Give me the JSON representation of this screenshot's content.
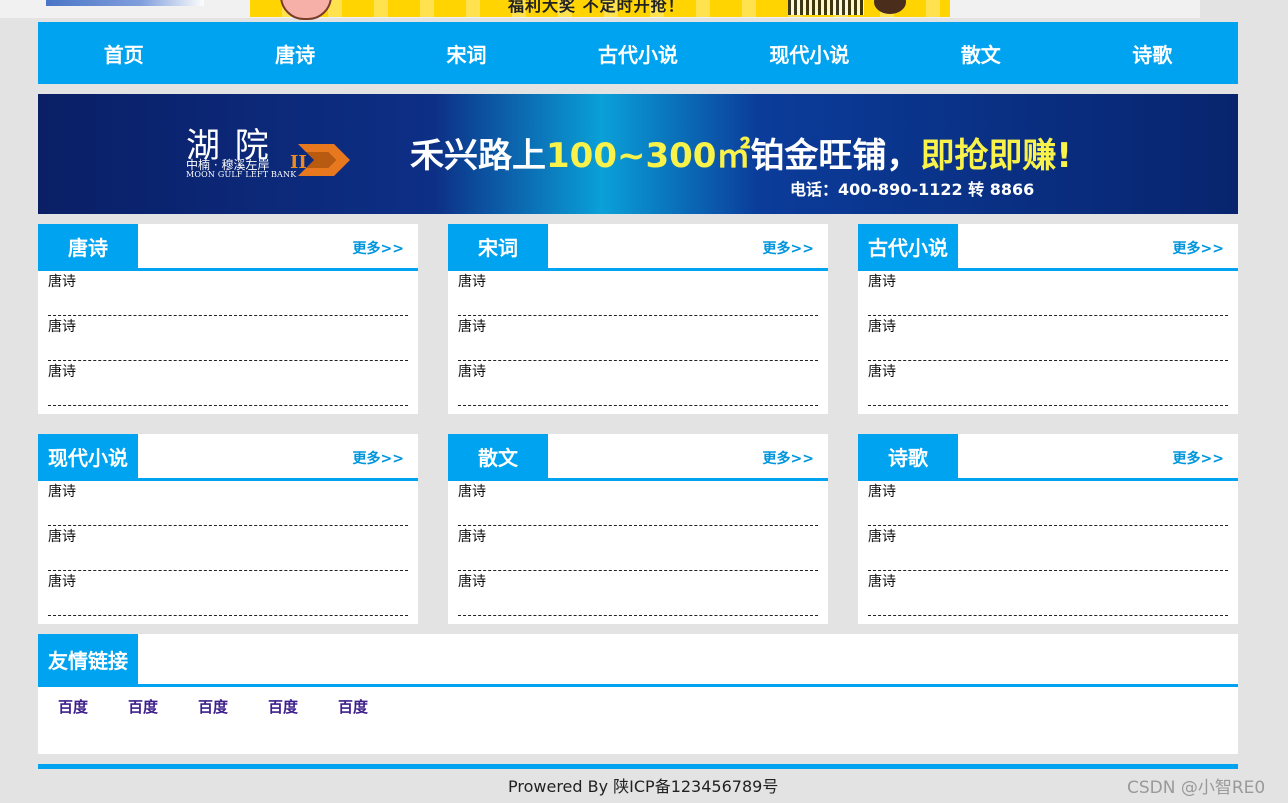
{
  "top_ad": {
    "text": "福利大奖 不定时开抢！"
  },
  "nav": {
    "items": [
      "首页",
      "唐诗",
      "宋词",
      "古代小说",
      "现代小说",
      "散文",
      "诗歌"
    ]
  },
  "banner": {
    "logo_zh": "湖 院",
    "logo_numeral": "II",
    "logo_sub": "中楠 · 穆溪左岸",
    "logo_en": "MOON GULF LEFT BANK",
    "headline_prefix": "禾兴路上",
    "headline_highlight": "100~300㎡",
    "headline_middle": "铂金旺铺，",
    "headline_cta": "即抢即赚!",
    "phone": "电话：400-890-1122 转 8866"
  },
  "sections": [
    {
      "title": "唐诗",
      "more": "更多>>",
      "items": [
        "唐诗",
        "唐诗",
        "唐诗"
      ]
    },
    {
      "title": "宋词",
      "more": "更多>>",
      "items": [
        "唐诗",
        "唐诗",
        "唐诗"
      ]
    },
    {
      "title": "古代小说",
      "more": "更多>>",
      "items": [
        "唐诗",
        "唐诗",
        "唐诗"
      ]
    },
    {
      "title": "现代小说",
      "more": "更多>>",
      "items": [
        "唐诗",
        "唐诗",
        "唐诗"
      ]
    },
    {
      "title": "散文",
      "more": "更多>>",
      "items": [
        "唐诗",
        "唐诗",
        "唐诗"
      ]
    },
    {
      "title": "诗歌",
      "more": "更多>>",
      "items": [
        "唐诗",
        "唐诗",
        "唐诗"
      ]
    }
  ],
  "links": {
    "title": "友情链接",
    "items": [
      "百度",
      "百度",
      "百度",
      "百度",
      "百度"
    ]
  },
  "footer": {
    "text": "Prowered By 陕ICP备123456789号"
  },
  "watermark": "CSDN @小智RE0",
  "colors": {
    "accent": "#00a3ef",
    "background": "#e3e3e3",
    "link": "#3d1f8a"
  }
}
